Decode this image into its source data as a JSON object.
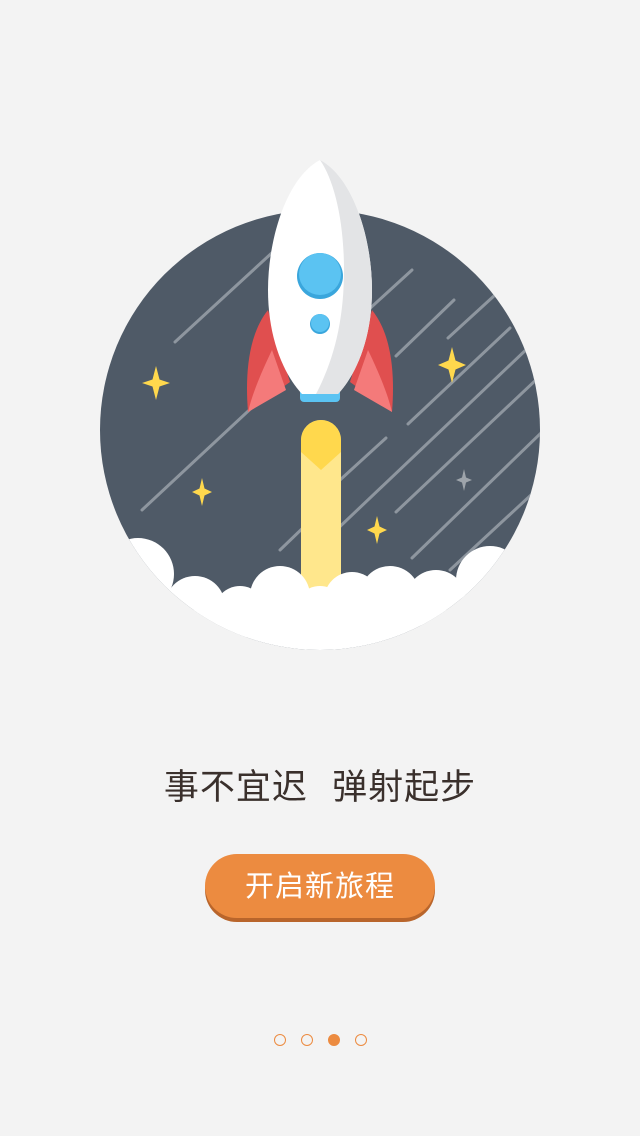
{
  "intro": {
    "tagline": "事不宜迟  弹射起步",
    "button_label": "开启新旅程"
  },
  "pager": {
    "page_count": 4,
    "active_index": 2
  },
  "colors": {
    "background": "#f3f3f3",
    "circle": "#4f5a67",
    "accent": "#ec8b40",
    "star": "#ffd84d",
    "rocket_window": "#5bc3f2",
    "rocket_fin": "#e04f4f",
    "flame": "#ffe78c",
    "cloud": "#ffffff",
    "text": "#3a302c"
  },
  "icons": [
    "rocket-icon",
    "star-icon",
    "cloud-icon"
  ]
}
